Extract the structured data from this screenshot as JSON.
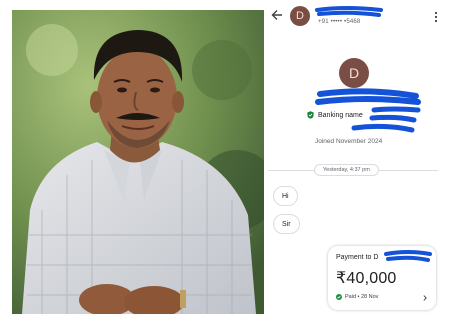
{
  "chat_header": {
    "avatar_initial": "D",
    "phone": "+91 ••••• •5468"
  },
  "profile": {
    "avatar_initial": "D",
    "banking_name_label": "Banking name",
    "joined": "Joined November 2024"
  },
  "conversation": {
    "date_separator": "Yesterday, 4:37 pm",
    "messages": [
      "Hi",
      "Sir"
    ]
  },
  "payment": {
    "title": "Payment to",
    "recipient_initial": "D",
    "amount": "₹40,000",
    "status": "Paid • 28 Nov"
  },
  "colors": {
    "avatar_bg": "#7b4e45",
    "redaction_blue": "#1452d8",
    "paid_green": "#1e8e3e",
    "verified_green": "#188038"
  }
}
